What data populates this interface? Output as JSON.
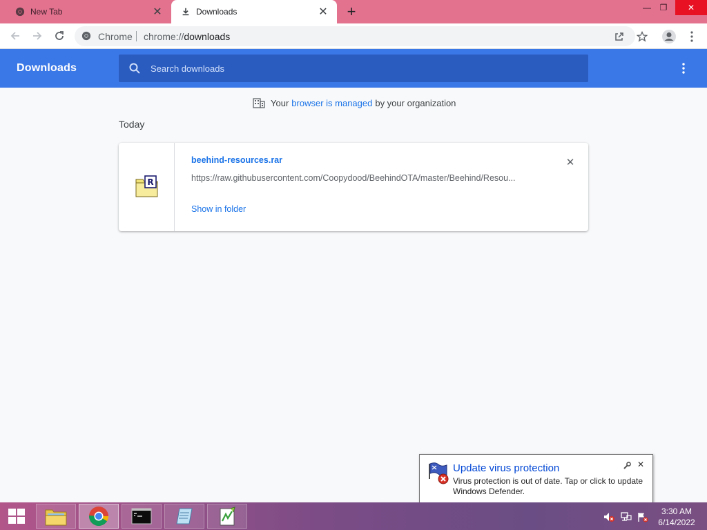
{
  "tabs": [
    {
      "title": "New Tab",
      "icon": "chrome-icon",
      "active": false
    },
    {
      "title": "Downloads",
      "icon": "download-icon",
      "active": true
    }
  ],
  "window_controls": {
    "minimize": "—",
    "restore": "❐",
    "close": "✕"
  },
  "toolbar": {
    "site_name": "Chrome",
    "url_scheme": "chrome://",
    "url_path": "downloads"
  },
  "downloads_page": {
    "title": "Downloads",
    "search_placeholder": "Search downloads",
    "managed_prefix": "Your",
    "managed_link": "browser is managed",
    "managed_suffix": "by your organization",
    "section_label": "Today",
    "items": [
      {
        "file_name": "beehind-resources.rar",
        "url": "https://raw.githubusercontent.com/Coopydood/BeehindOTA/master/Beehind/Resou...",
        "action": "Show in folder",
        "icon": "rar-file-icon"
      }
    ]
  },
  "notification": {
    "title": "Update virus protection",
    "message": "Virus protection is out of date. Tap or click to update Windows Defender."
  },
  "taskbar": {
    "apps": [
      "file-explorer",
      "chrome",
      "command-prompt",
      "notepad",
      "notepad-plus-plus"
    ],
    "time": "3:30 AM",
    "date": "6/14/2022"
  },
  "colors": {
    "tabstrip": "#e3728f",
    "header": "#3b78e7",
    "link": "#1a73e8",
    "notification_title": "#0046d5"
  }
}
